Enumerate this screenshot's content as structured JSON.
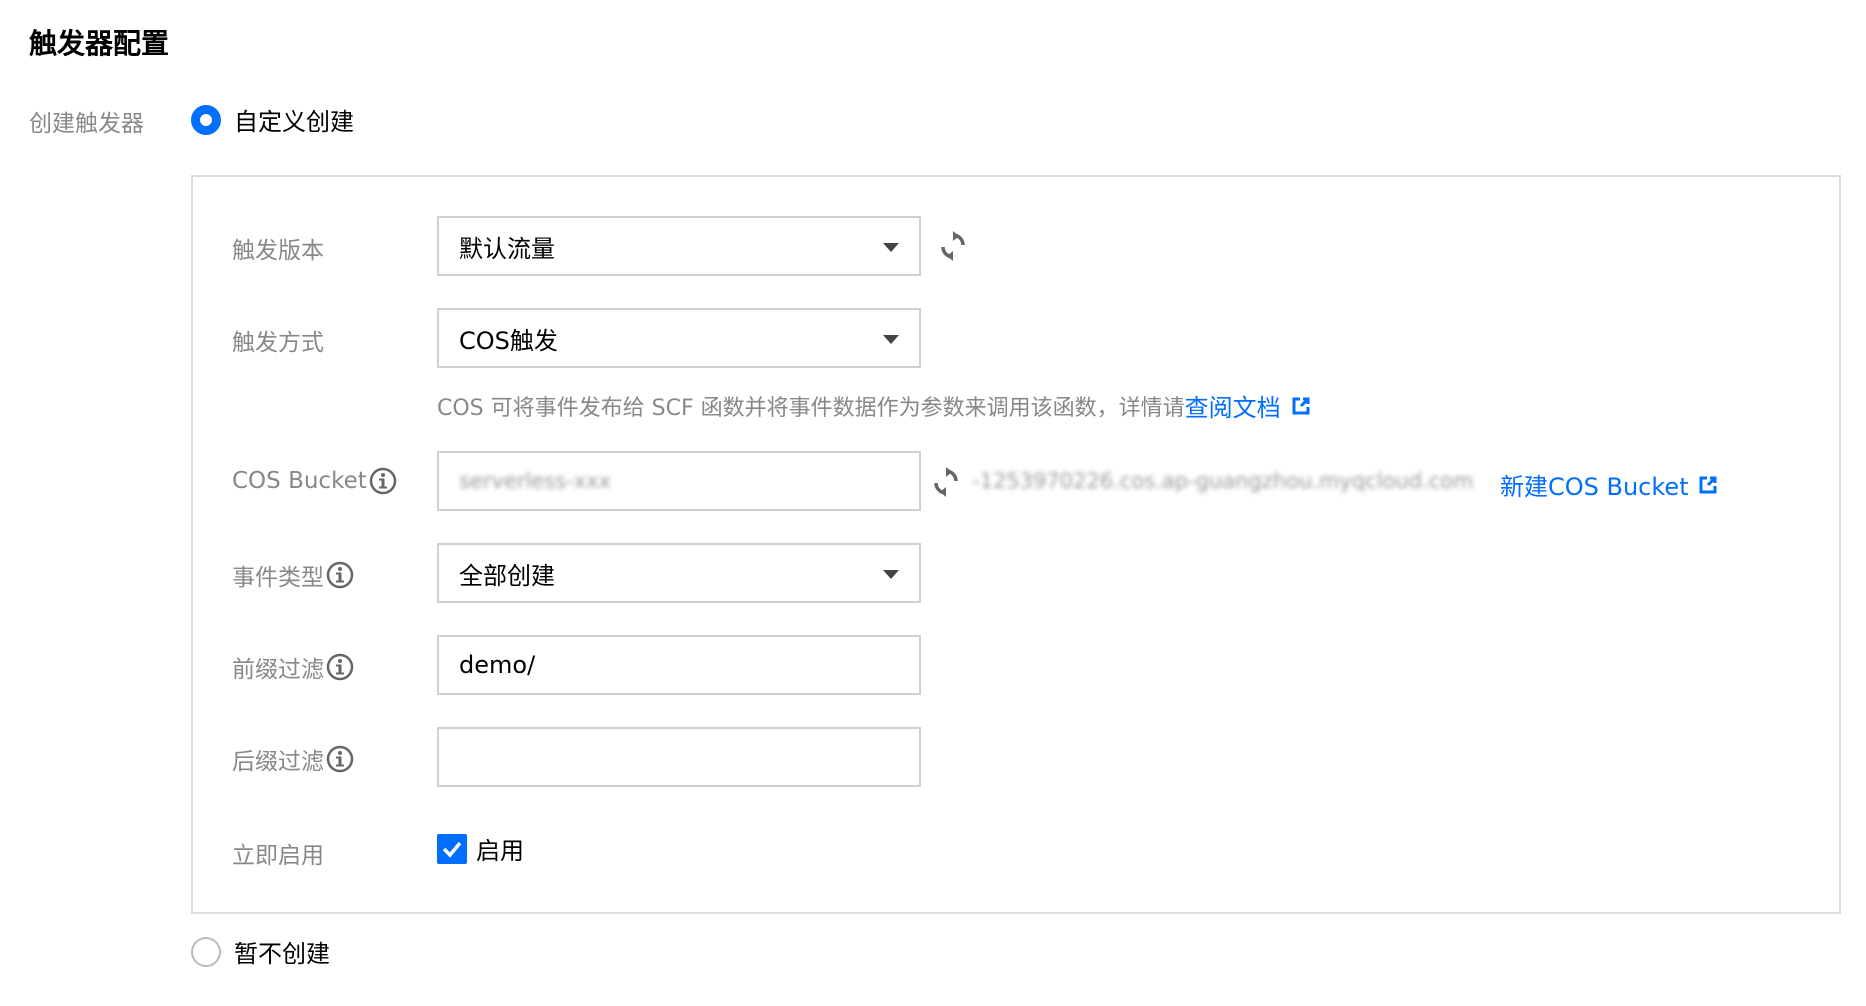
{
  "section_title": "触发器配置",
  "create_trigger": {
    "label": "创建触发器",
    "option_custom": "自定义创建",
    "option_none": "暂不创建"
  },
  "form": {
    "version": {
      "label": "触发版本",
      "value": "默认流量"
    },
    "method": {
      "label": "触发方式",
      "value": "COS触发",
      "hint": "COS 可将事件发布给 SCF 函数并将事件数据作为参数来调用该函数，详情请",
      "hint_link": "查阅文档"
    },
    "bucket": {
      "label": "COS Bucket",
      "value": "serverless-xxx",
      "domain": "-1253970226.cos.ap-guangzhou.myqcloud.com",
      "new_link": "新建COS Bucket"
    },
    "event_type": {
      "label": "事件类型",
      "value": "全部创建"
    },
    "prefix": {
      "label": "前缀过滤",
      "value": "demo/"
    },
    "suffix": {
      "label": "后缀过滤",
      "value": ""
    },
    "enable": {
      "label": "立即启用",
      "checkbox_label": "启用",
      "checked": true
    }
  },
  "colors": {
    "accent": "#006eff",
    "label_gray": "#888888",
    "border": "#d0d0d0"
  },
  "icons": [
    "refresh-icon",
    "info-icon",
    "external-link-icon",
    "caret-down-icon",
    "check-icon"
  ]
}
